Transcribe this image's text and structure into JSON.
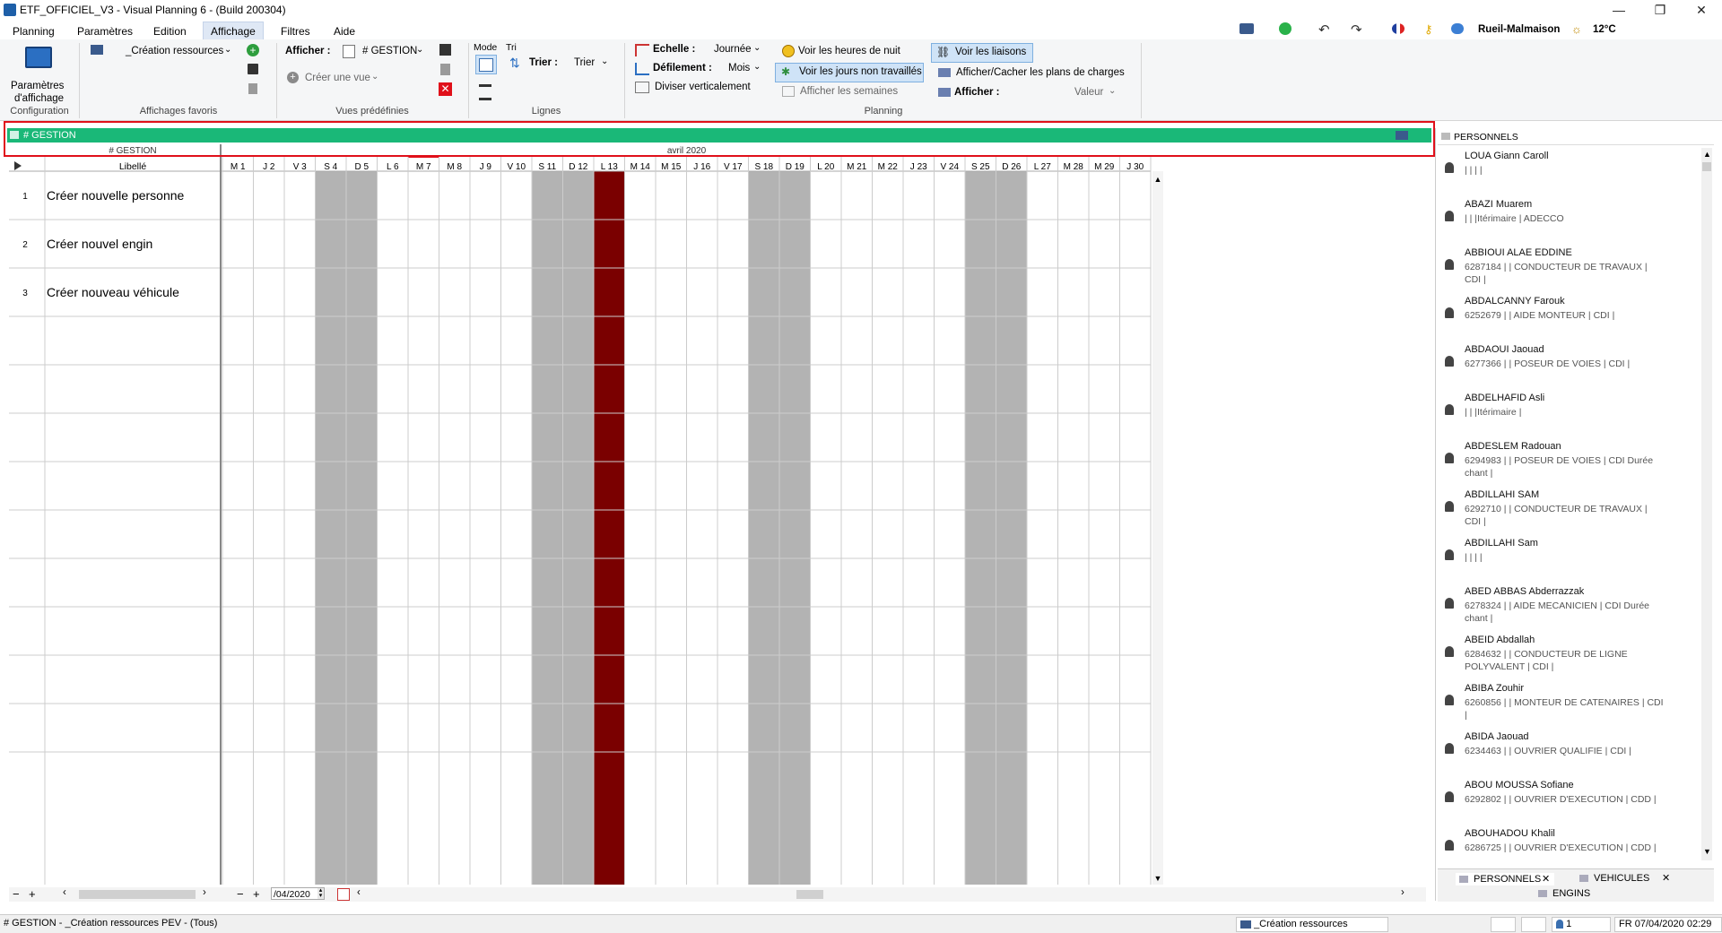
{
  "window": {
    "title": "ETF_OFFICIEL_V3 - Visual Planning 6 - (Build 200304)",
    "minimize": "—",
    "restore": "❐",
    "close": "✕"
  },
  "menu": [
    "Planning",
    "Paramètres",
    "Edition",
    "Affichage",
    "Filtres",
    "Aide"
  ],
  "menu_active": "Affichage",
  "topright": {
    "location": "Rueil-Malmaison",
    "temperature": "12°C"
  },
  "ribbon": {
    "config": {
      "button_line1": "Paramètres",
      "button_line2": "d'affichage",
      "group": "Configuration"
    },
    "favoris": {
      "selected": "_Création ressources",
      "group": "Affichages favoris"
    },
    "vues": {
      "afficher_label": "Afficher :",
      "afficher_value": "# GESTION",
      "create_view": "Créer une vue",
      "group": "Vues prédéfinies"
    },
    "lignes": {
      "mode_label": "Mode",
      "tri_label": "Tri",
      "trier_label": "Trier :",
      "trier_value": "Trier",
      "group": "Lignes"
    },
    "planning": {
      "echelle_label": "Echelle :",
      "echelle_value": "Journée",
      "defilement_label": "Défilement :",
      "defilement_value": "Mois",
      "diviser": "Diviser verticalement",
      "heures_nuit": "Voir les heures de nuit",
      "jours_non_travailles": "Voir les jours non travaillés",
      "semaines": "Afficher les semaines",
      "liaisons": "Voir les liaisons",
      "plans_charges": "Afficher/Cacher les plans de charges",
      "afficher_label": "Afficher :",
      "afficher_value": "Valeur",
      "group": "Planning"
    }
  },
  "view_bar": {
    "title": "# GESTION"
  },
  "grid": {
    "col_header_left": "# GESTION",
    "col_header_libelle": "Libellé",
    "month": "avril 2020",
    "days": [
      "M 1",
      "J 2",
      "V 3",
      "S 4",
      "D 5",
      "L 6",
      "M 7",
      "M 8",
      "J 9",
      "V 10",
      "S 11",
      "D 12",
      "L 13",
      "M 14",
      "M 15",
      "J 16",
      "V 17",
      "S 18",
      "D 19",
      "L 20",
      "M 21",
      "M 22",
      "J 23",
      "V 24",
      "S 25",
      "D 26",
      "L 27",
      "M 28",
      "M 29",
      "J 30"
    ],
    "weekend_indices": [
      3,
      4,
      10,
      11,
      17,
      18,
      24,
      25
    ],
    "holiday_indices": [
      12
    ],
    "today_index": 6,
    "rows": [
      {
        "num": "1",
        "label": "Créer nouvelle personne"
      },
      {
        "num": "2",
        "label": "Créer nouvel engin"
      },
      {
        "num": "3",
        "label": "Créer nouveau véhicule"
      },
      {
        "num": "",
        "label": ""
      },
      {
        "num": "",
        "label": ""
      },
      {
        "num": "",
        "label": ""
      },
      {
        "num": "",
        "label": ""
      },
      {
        "num": "",
        "label": ""
      },
      {
        "num": "",
        "label": ""
      },
      {
        "num": "",
        "label": ""
      },
      {
        "num": "",
        "label": ""
      },
      {
        "num": "",
        "label": ""
      }
    ],
    "date_input": "/04/2020",
    "colors": {
      "weekend": "#b3b3b3",
      "holiday": "#7a0000",
      "today_marker": "#e0101a"
    }
  },
  "right_panel": {
    "header": "PERSONNELS",
    "people": [
      {
        "name": "LOUA Giann Caroll",
        "detail": "| | | |"
      },
      {
        "name": "ABAZI Muarem",
        "detail": "| | |Itérimaire | ADECCO"
      },
      {
        "name": "ABBIOUI ALAE EDDINE",
        "detail": "6287184 | | CONDUCTEUR DE TRAVAUX |",
        "detail2": "CDI |"
      },
      {
        "name": "ABDALCANNY Farouk",
        "detail": "6252679 | | AIDE MONTEUR | CDI |"
      },
      {
        "name": "ABDAOUI Jaouad",
        "detail": "6277366 | | POSEUR DE VOIES | CDI |"
      },
      {
        "name": "ABDELHAFID Asli",
        "detail": "| | |Itérimaire |"
      },
      {
        "name": "ABDESLEM Radouan",
        "detail": "6294983 | | POSEUR DE VOIES | CDI Durée",
        "detail2": "chant |"
      },
      {
        "name": "ABDILLAHI SAM",
        "detail": "6292710 | | CONDUCTEUR DE TRAVAUX |",
        "detail2": "CDI |"
      },
      {
        "name": "ABDILLAHI Sam",
        "detail": "| | | |"
      },
      {
        "name": "ABED ABBAS Abderrazzak",
        "detail": "6278324 | | AIDE MECANICIEN | CDI Durée",
        "detail2": "chant |"
      },
      {
        "name": "ABEID Abdallah",
        "detail": "6284632 | | CONDUCTEUR DE LIGNE",
        "detail2": "POLYVALENT | CDI |"
      },
      {
        "name": "ABIBA Zouhir",
        "detail": "6260856 | | MONTEUR DE CATENAIRES | CDI",
        "detail2": "|"
      },
      {
        "name": "ABIDA Jaouad",
        "detail": "6234463 | | OUVRIER QUALIFIE | CDI |"
      },
      {
        "name": "ABOU MOUSSA Sofiane",
        "detail": "6292802 | | OUVRIER D'EXECUTION | CDD |"
      },
      {
        "name": "ABOUHADOU Khalil",
        "detail": "6286725 | | OUVRIER D'EXECUTION | CDD |"
      }
    ],
    "tabs": [
      "PERSONNELS",
      "VEHICULES",
      "ENGINS"
    ]
  },
  "status": {
    "left": "# GESTION - _Création ressources PEV - (Tous)",
    "view": "_Création ressources",
    "count": "1",
    "datetime": "FR 07/04/2020 02:29"
  }
}
